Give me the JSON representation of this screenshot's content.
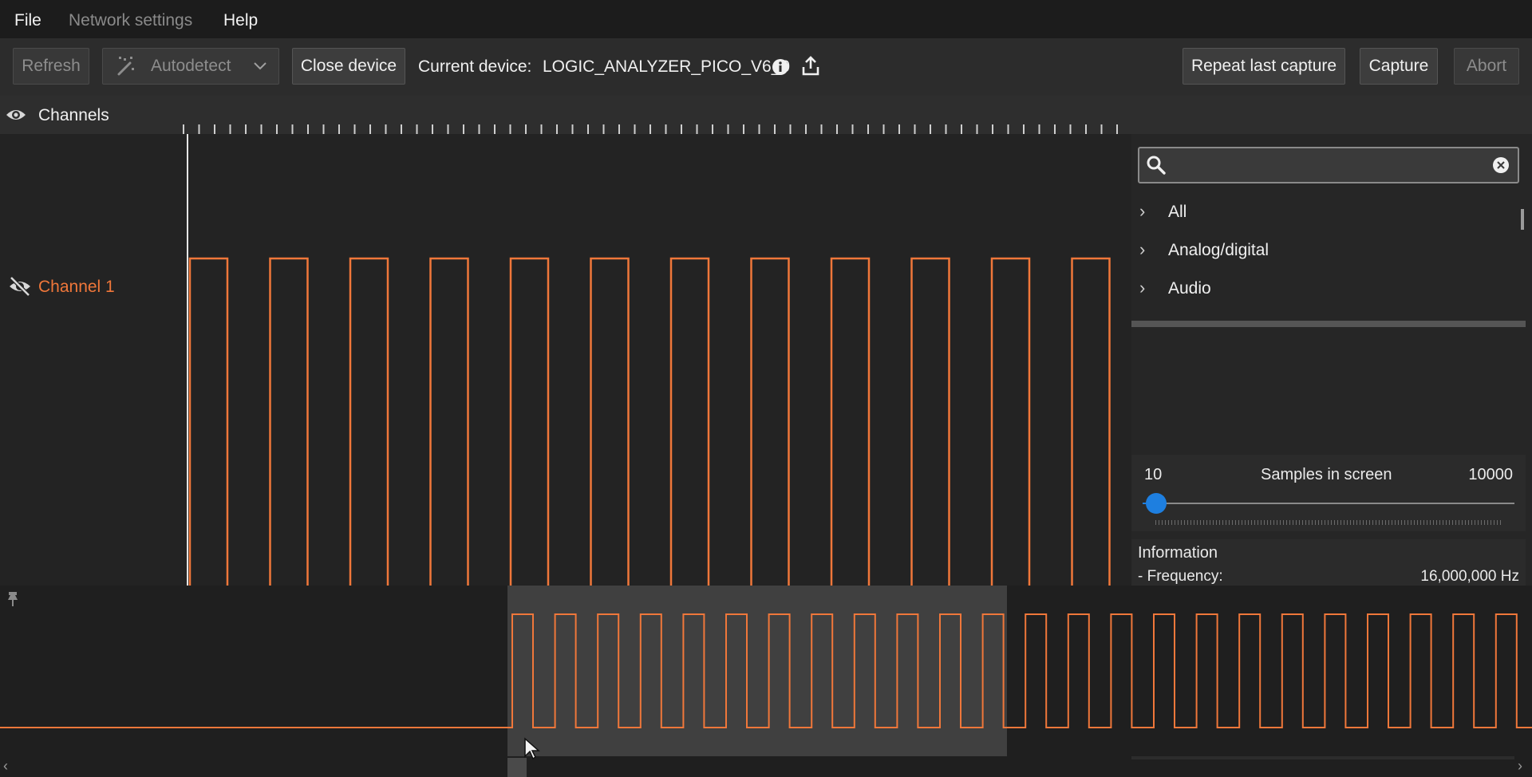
{
  "menu": {
    "file": "File",
    "network": "Network settings",
    "help": "Help"
  },
  "toolbar": {
    "refresh": "Refresh",
    "autodetect": "Autodetect",
    "close_device": "Close device",
    "current_device_label": "Current device:",
    "current_device_value": "LOGIC_ANALYZER_PICO_V6_0",
    "repeat_capture": "Repeat last capture",
    "capture": "Capture",
    "abort": "Abort"
  },
  "channels": {
    "header": "Channels",
    "items": [
      {
        "label": "Channel 1",
        "color": "#f0773a"
      }
    ]
  },
  "protocols": {
    "search_value": "",
    "items": [
      "All",
      "Analog/digital",
      "Audio"
    ]
  },
  "samples": {
    "min": "10",
    "title": "Samples in screen",
    "max": "10000",
    "level": 0.003
  },
  "information": {
    "title": "Information",
    "frequency_label": "- Frequency:",
    "frequency_value": "16,000,000 Hz"
  },
  "colors": {
    "signal": "#f0773a",
    "accent": "#1e7fe0"
  },
  "icons": [
    "wand-icon",
    "chevron-down-icon",
    "info-icon",
    "upload-icon",
    "eye-icon",
    "eye-slash-icon",
    "search-icon",
    "clear-icon",
    "chevron-right-icon",
    "pin-icon",
    "cursor-icon"
  ]
}
